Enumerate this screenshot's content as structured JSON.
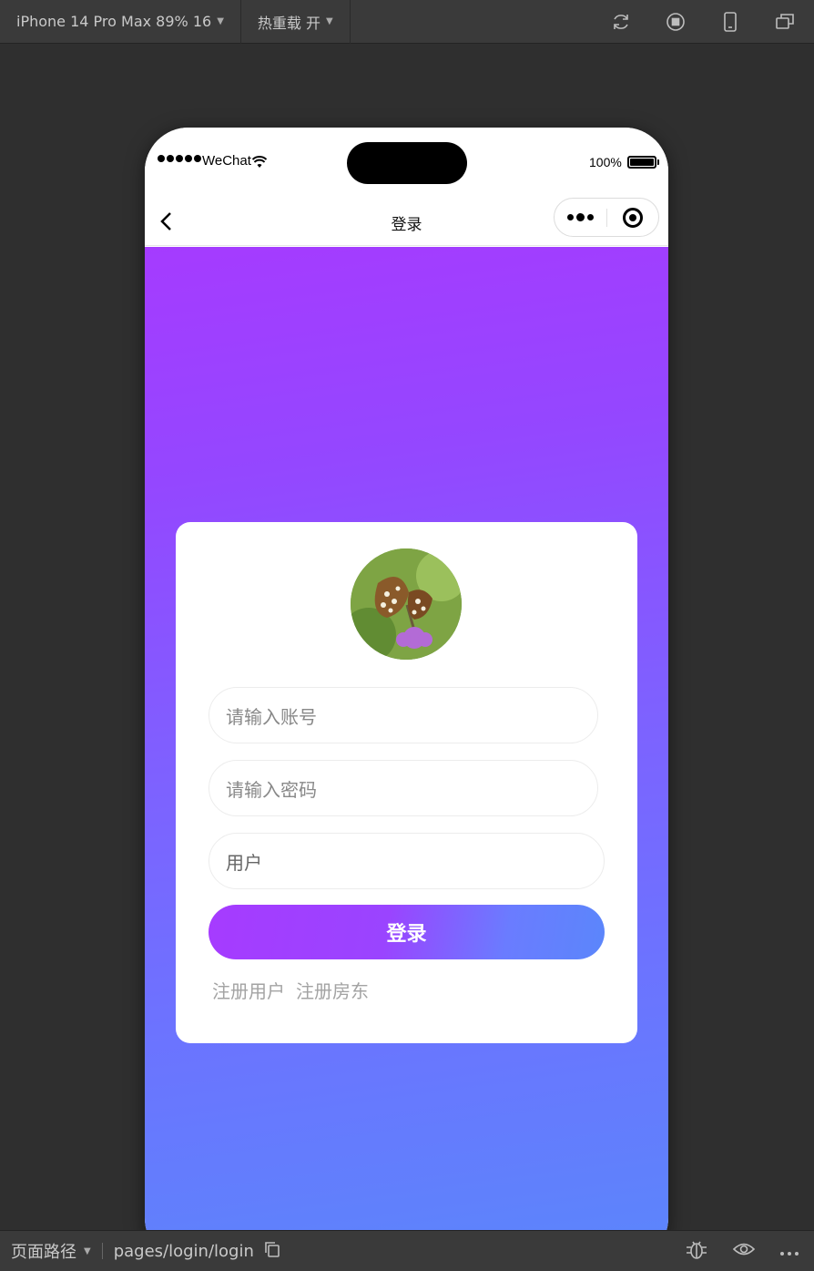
{
  "toolbar": {
    "device_label": "iPhone 14 Pro Max 89% 16",
    "hot_reload_label": "热重载 开",
    "icons": [
      "refresh-icon",
      "stop-icon",
      "phone-icon",
      "window-icon"
    ]
  },
  "status_bar": {
    "carrier": "WeChat",
    "battery": "100%"
  },
  "nav": {
    "title": "登录"
  },
  "login_form": {
    "account_placeholder": "请输入账号",
    "password_placeholder": "请输入密码",
    "role_value": "用户",
    "login_button": "登录",
    "register_user": "注册用户",
    "register_landlord": "注册房东"
  },
  "bottom_bar": {
    "page_path_label": "页面路径",
    "page_path": "pages/login/login",
    "icons": [
      "copy-icon",
      "bug-icon",
      "eye-icon",
      "more-icon"
    ]
  },
  "colors": {
    "gradient_top": "#a53bff",
    "gradient_bottom": "#5b86fb",
    "button_start": "#a63bff",
    "button_end": "#5b86fb"
  }
}
